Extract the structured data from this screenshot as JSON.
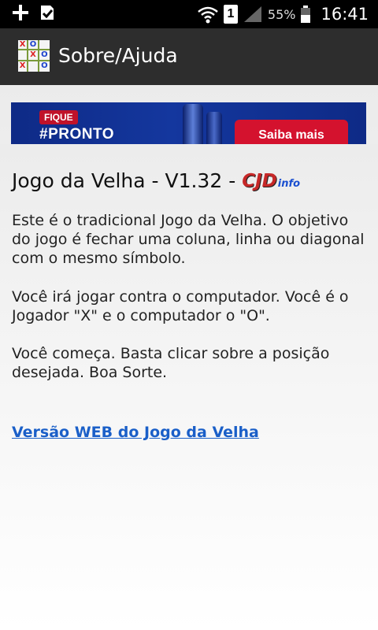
{
  "status_bar": {
    "icons": [
      "plus-icon",
      "download-check-icon",
      "wifi-icon",
      "sim-1-icon",
      "signal-icon",
      "battery-icon"
    ],
    "sim_label": "1",
    "battery_percent": "55%",
    "time": "16:41"
  },
  "action_bar": {
    "title": "Sobre/Ajuda",
    "app_icon": "tic-tac-toe-icon",
    "app_icon_cells": [
      "X",
      "O",
      "",
      "",
      "X",
      "O",
      "X",
      "",
      "O"
    ]
  },
  "ad": {
    "tag": "FIQUE",
    "headline": "#PRONTO",
    "button_label": "Saiba mais"
  },
  "content": {
    "heading": "Jogo da Velha - V1.32 -",
    "logo_main": "CJD",
    "logo_sub": "info",
    "paragraph1": "Este é o tradicional Jogo da Velha. O objetivo do jogo é fechar uma coluna, linha ou diagonal com o mesmo símbolo.",
    "paragraph2": "Você irá jogar contra o computador. Você é o Jogador \"X\" e o computador o \"O\".",
    "paragraph3": "Você começa. Basta clicar sobre a posição desejada. Boa Sorte.",
    "link": "Versão WEB do Jogo da Velha"
  },
  "colors": {
    "status_bar_bg": "#000000",
    "action_bar_bg": "#2d2d2d",
    "link": "#1a5fc8",
    "ad_bg": "#14379e",
    "ad_button": "#d4122e"
  }
}
